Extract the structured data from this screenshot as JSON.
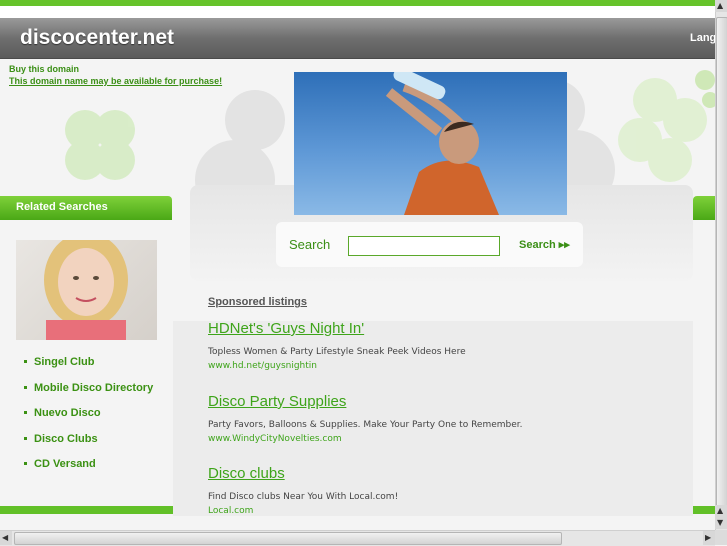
{
  "header": {
    "site_title": "discocenter.net",
    "language_label": "Lang"
  },
  "domain_notice": {
    "buy_label": "Buy this domain",
    "available_label": "This domain name may be available for purchase!"
  },
  "related": {
    "title": "Related Searches",
    "items": [
      {
        "label": "Singel Club"
      },
      {
        "label": "Mobile Disco Directory"
      },
      {
        "label": "Nuevo Disco"
      },
      {
        "label": "Disco Clubs"
      },
      {
        "label": "CD Versand"
      }
    ]
  },
  "search": {
    "label": "Search",
    "input_value": "",
    "button_label": "Search ▸▸"
  },
  "sponsored": {
    "heading": "Sponsored listings",
    "listings": [
      {
        "title": "HDNet's 'Guys Night In'",
        "description": "Topless Women & Party Lifestyle Sneak Peek Videos Here",
        "url": "www.hd.net/guysnightin"
      },
      {
        "title": "Disco Party Supplies",
        "description": "Party Favors, Balloons & Supplies. Make Your Party One to Remember.",
        "url": "www.WindyCityNovelties.com"
      },
      {
        "title": "Disco clubs",
        "description": "Find Disco clubs Near You With Local.com!",
        "url": "Local.com"
      }
    ]
  },
  "colors": {
    "accent_green": "#4aa816",
    "link_green": "#3ea41a",
    "header_gray": "#6f6f6f"
  }
}
